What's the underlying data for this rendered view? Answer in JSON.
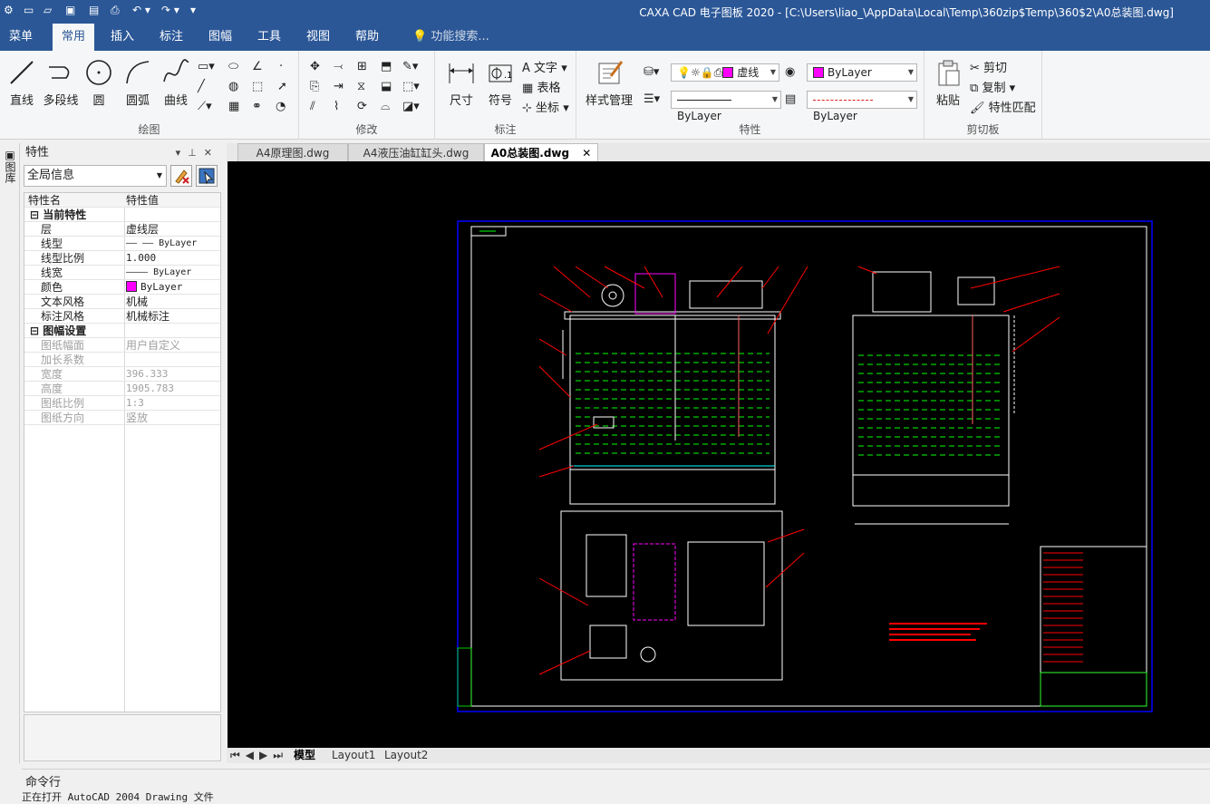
{
  "titlebar": {
    "title": "CAXA CAD 电子图板 2020 - [C:\\Users\\liao_\\AppData\\Local\\Temp\\360zip$Temp\\360$2\\A0总装图.dwg]"
  },
  "ribbon_tabs": [
    "菜单",
    "常用",
    "插入",
    "标注",
    "图幅",
    "工具",
    "视图",
    "帮助"
  ],
  "active_tab": "常用",
  "search_placeholder": "功能搜索...",
  "groups": {
    "draw": {
      "label": "绘图",
      "buttons": [
        "直线",
        "多段线",
        "圆",
        "圆弧",
        "曲线"
      ]
    },
    "modify": {
      "label": "修改"
    },
    "annotate": {
      "label": "标注",
      "big": [
        "尺寸",
        "符号"
      ],
      "small": [
        "文字",
        "表格",
        "坐标"
      ]
    },
    "properties": {
      "label": "特性",
      "style_manage": "样式管理",
      "layer_value": "虚线",
      "color_value": "ByLayer",
      "linetype_value": "ByLayer",
      "lineweight_value": "ByLayer"
    },
    "clipboard": {
      "label": "剪切板",
      "paste": "粘贴",
      "cut": "剪切",
      "copy": "复制",
      "match": "特性匹配"
    }
  },
  "left_strip_label": "图库",
  "panel": {
    "title": "特性",
    "selector": "全局信息",
    "col_name": "特性名",
    "col_value": "特性值",
    "sections": [
      {
        "name": "当前特性",
        "rows": [
          {
            "name": "层",
            "value": "虚线层"
          },
          {
            "name": "线型",
            "value": "—— —— ByLayer"
          },
          {
            "name": "线型比例",
            "value": "1.000"
          },
          {
            "name": "线宽",
            "value": "———— ByLayer"
          },
          {
            "name": "颜色",
            "value": "ByLayer"
          },
          {
            "name": "文本风格",
            "value": "机械"
          },
          {
            "name": "标注风格",
            "value": "机械标注"
          }
        ]
      },
      {
        "name": "图幅设置",
        "rows": [
          {
            "name": "图纸幅面",
            "value": "用户自定义"
          },
          {
            "name": "加长系数",
            "value": ""
          },
          {
            "name": "宽度",
            "value": "396.333"
          },
          {
            "name": "高度",
            "value": "1905.783"
          },
          {
            "name": "图纸比例",
            "value": "1:3"
          },
          {
            "name": "图纸方向",
            "value": "竖放"
          }
        ]
      }
    ]
  },
  "doc_tabs": [
    "A4原理图.dwg",
    "A4液压油缸缸头.dwg",
    "A0总装图.dwg"
  ],
  "active_doc": "A0总装图.dwg",
  "layout_tabs": [
    "模型",
    "Layout1",
    "Layout2"
  ],
  "command": {
    "label": "命令行",
    "last_line": "正在打开 AutoCAD 2004 Drawing 文件"
  },
  "colors": {
    "titlebar": "#2b5797",
    "canvas": "#000000",
    "sheet_frame": "#0000ff",
    "accent_magenta": "#ff00ff",
    "hatch_green": "#00ff00",
    "leader_red": "#ff0000"
  }
}
